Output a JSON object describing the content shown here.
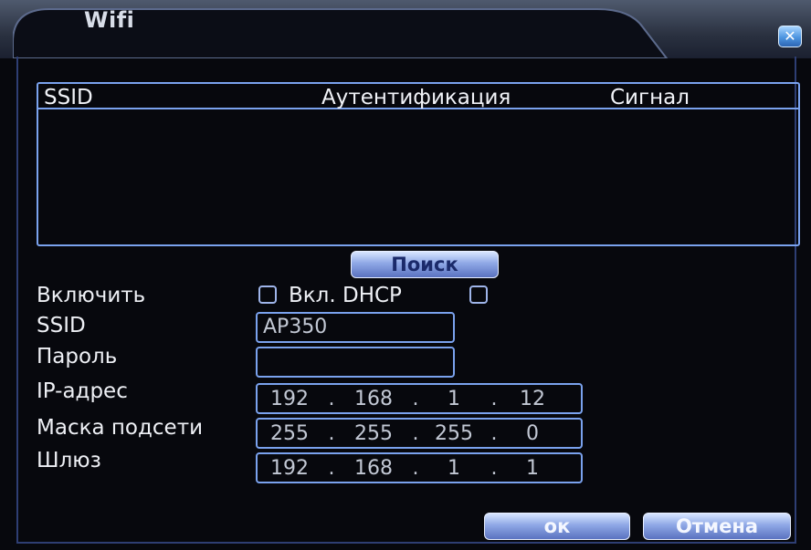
{
  "window": {
    "title": "Wifi",
    "close_icon": "close-icon"
  },
  "network_list": {
    "columns": [
      "SSID",
      "Аутентификация",
      "Сигнал"
    ],
    "rows": []
  },
  "search_button": "Поиск",
  "form": {
    "enable_label": "Включить",
    "enable_checked": false,
    "dhcp_label": "Вкл. DHCP",
    "dhcp_checked": false,
    "ssid_label": "SSID",
    "ssid_value": "AP350",
    "password_label": "Пароль",
    "password_value": "",
    "ip_label": "IP-адрес",
    "ip": [
      "192",
      "168",
      "1",
      "12"
    ],
    "mask_label": "Маска подсети",
    "mask": [
      "255",
      "255",
      "255",
      "0"
    ],
    "gateway_label": "Шлюз",
    "gateway": [
      "192",
      "168",
      "1",
      "1"
    ]
  },
  "buttons": {
    "ok": "ок",
    "cancel": "Отмена"
  },
  "colors": {
    "background": "#07080d",
    "border_accent": "#7aa2ee",
    "button_gradient_top": "#d8e6ff",
    "button_gradient_bottom": "#5a72c0"
  }
}
